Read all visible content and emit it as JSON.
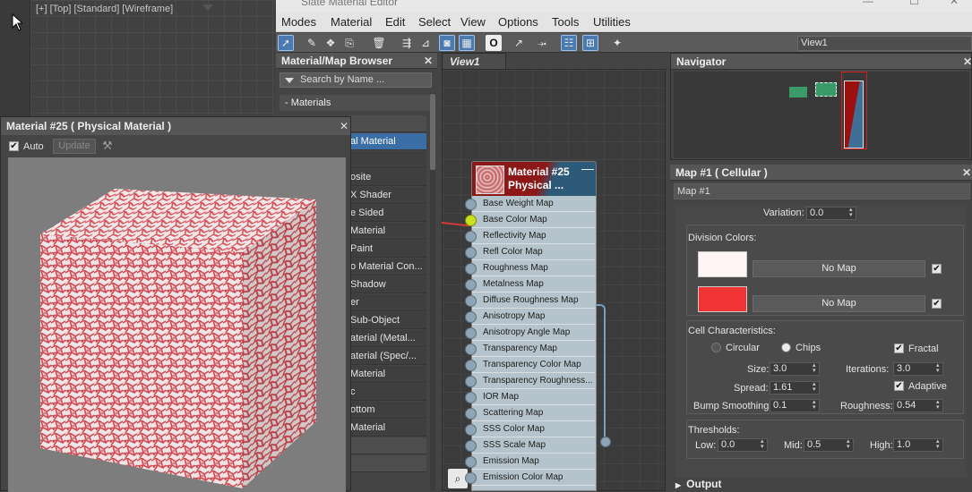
{
  "viewport": {
    "label": "[+] [Top] [Standard] [Wireframe]"
  },
  "window": {
    "title": "Slate Material Editor"
  },
  "menu": [
    "Modes",
    "Material",
    "Edit",
    "Select",
    "View",
    "Options",
    "Tools",
    "Utilities"
  ],
  "toolbar": {
    "view_select": "View1"
  },
  "browser": {
    "title": "Material/Map Browser",
    "search_placeholder": "Search by Name ...",
    "materials_header": "- Materials",
    "items": [
      "",
      "al Material",
      "",
      "osite",
      "X Shader",
      "e Sided",
      "Material",
      "Paint",
      "o Material Con...",
      "Shadow",
      "er",
      "Sub-Object",
      "aterial (Metal...",
      "aterial (Spec/...",
      "Material",
      "c",
      "ottom",
      "Material",
      "",
      ""
    ]
  },
  "view1": {
    "tab": "View1"
  },
  "node": {
    "title_line1": "Material #25",
    "title_line2": "Physical ...",
    "slots": [
      "Base Weight Map",
      "Base Color Map",
      "Reflectivity Map",
      "Refl Color Map",
      "Roughness Map",
      "Metalness Map",
      "Diffuse Roughness Map",
      "Anisotropy Map",
      "Anisotropy Angle Map",
      "Transparency Map",
      "Transparency Color Map",
      "Transparency Roughness...",
      "IOR Map",
      "Scattering Map",
      "SSS Color Map",
      "SSS Scale Map",
      "Emission Map",
      "Emission Color Map"
    ]
  },
  "navigator": {
    "title": "Navigator"
  },
  "params": {
    "title": "Map #1  ( Cellular )",
    "name_value": "Map #1",
    "variation_label": "Variation:",
    "variation_value": "0.0",
    "division_colors_label": "Division Colors:",
    "color1": "#fff5f5",
    "color2": "#f03434",
    "nomap1": "No Map",
    "nomap2": "No Map",
    "cell_label": "Cell Characteristics:",
    "circular": "Circular",
    "chips": "Chips",
    "fractal": "Fractal",
    "size_label": "Size:",
    "size_value": "3.0",
    "iterations_label": "Iterations:",
    "iterations_value": "3.0",
    "spread_label": "Spread:",
    "spread_value": "1.61",
    "adaptive": "Adaptive",
    "bump_label": "Bump Smoothing:",
    "bump_value": "0.1",
    "roughness_label": "Roughness:",
    "roughness_value": "0.54",
    "thresholds_label": "Thresholds:",
    "low_label": "Low:",
    "low_value": "0.0",
    "mid_label": "Mid:",
    "mid_value": "0.5",
    "high_label": "High:",
    "high_value": "1.0",
    "output": "Output"
  },
  "floatwin": {
    "title": "Material #25  ( Physical Material )",
    "auto": "Auto",
    "update": "Update"
  }
}
